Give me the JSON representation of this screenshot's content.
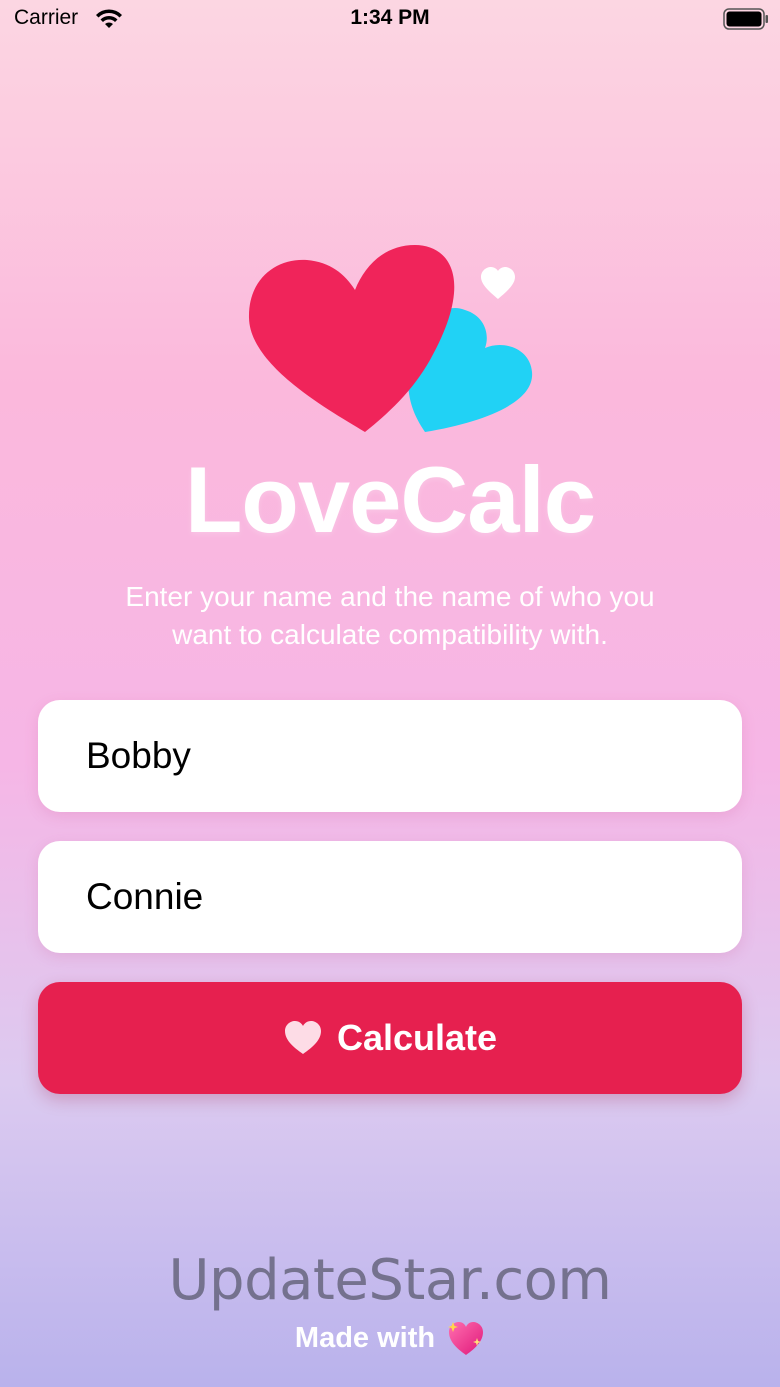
{
  "status_bar": {
    "carrier": "Carrier",
    "time": "1:34 PM"
  },
  "app": {
    "title": "LoveCalc",
    "subtitle_line1": "Enter your name and the name of who you",
    "subtitle_line2": "want to calculate compatibility with."
  },
  "form": {
    "first_name_value": "Bobby",
    "second_name_value": "Connie",
    "calculate_label": "Calculate"
  },
  "watermark": "UpdateStar.com",
  "footer": {
    "made_with": "Made with"
  },
  "colors": {
    "primary_heart": "#f0245a",
    "secondary_heart": "#21d2f5",
    "button": "#e6204f"
  },
  "icons": [
    "wifi-icon",
    "battery-icon",
    "hearts-logo-icon",
    "heart-icon",
    "sparkle-heart-icon"
  ]
}
